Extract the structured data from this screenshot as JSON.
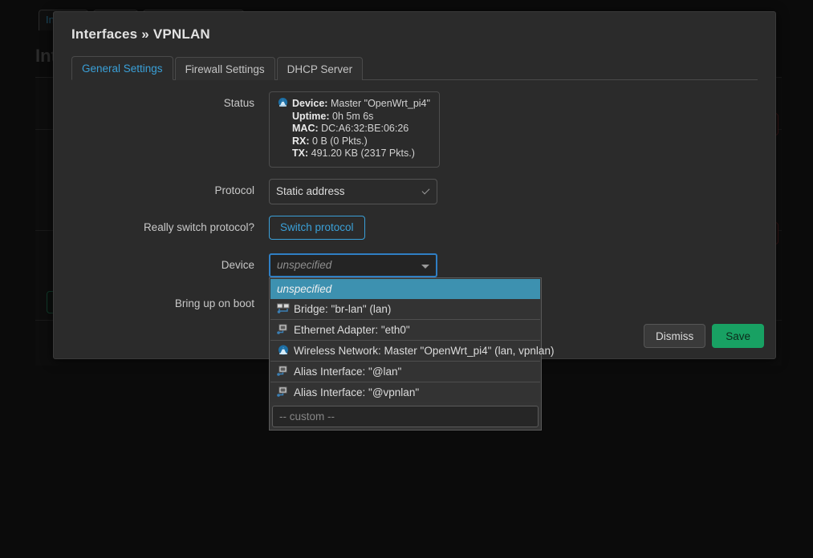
{
  "background": {
    "tabs": [
      "Int",
      "",
      ""
    ],
    "heading": "Int"
  },
  "modal": {
    "title": "Interfaces » VPNLAN",
    "tabs": [
      {
        "label": "General Settings",
        "active": true
      },
      {
        "label": "Firewall Settings",
        "active": false
      },
      {
        "label": "DHCP Server",
        "active": false
      }
    ],
    "accent_blue": "#3aa0d8",
    "focus_blue": "#2f7fc4",
    "highlight_teal": "#3d91b0",
    "save_green": "#18a163",
    "form": {
      "status": {
        "label": "Status",
        "icon": "wireless-icon",
        "lines": [
          {
            "key": "Device:",
            "value": "Master \"OpenWrt_pi4\""
          },
          {
            "key": "Uptime:",
            "value": "0h 5m 6s"
          },
          {
            "key": "MAC:",
            "value": "DC:A6:32:BE:06:26"
          },
          {
            "key": "RX:",
            "value": "0 B (0 Pkts.)"
          },
          {
            "key": "TX:",
            "value": "491.20 KB (2317 Pkts.)"
          }
        ]
      },
      "protocol": {
        "label": "Protocol",
        "value": "Static address",
        "options": [
          "Static address"
        ]
      },
      "switch_protocol": {
        "label": "Really switch protocol?",
        "button": "Switch protocol"
      },
      "device": {
        "label": "Device",
        "value": "unspecified",
        "placeholder": "unspecified",
        "options": [
          {
            "label": "unspecified",
            "icon": "none",
            "selected": true
          },
          {
            "label": "Bridge: \"br-lan\" (lan)",
            "icon": "bridge-icon",
            "selected": false
          },
          {
            "label": "Ethernet Adapter: \"eth0\"",
            "icon": "ethernet-icon",
            "selected": false
          },
          {
            "label": "Wireless Network: Master \"OpenWrt_pi4\" (lan, vpnlan)",
            "icon": "wireless-icon",
            "selected": false
          },
          {
            "label": "Alias Interface: \"@lan\"",
            "icon": "alias-icon",
            "selected": false
          },
          {
            "label": "Alias Interface: \"@vpnlan\"",
            "icon": "alias-icon",
            "selected": false
          }
        ],
        "custom_placeholder": "-- custom --"
      },
      "bring_up_on_boot": {
        "label": "Bring up on boot"
      }
    },
    "footer": {
      "dismiss": "Dismiss",
      "save": "Save"
    }
  }
}
